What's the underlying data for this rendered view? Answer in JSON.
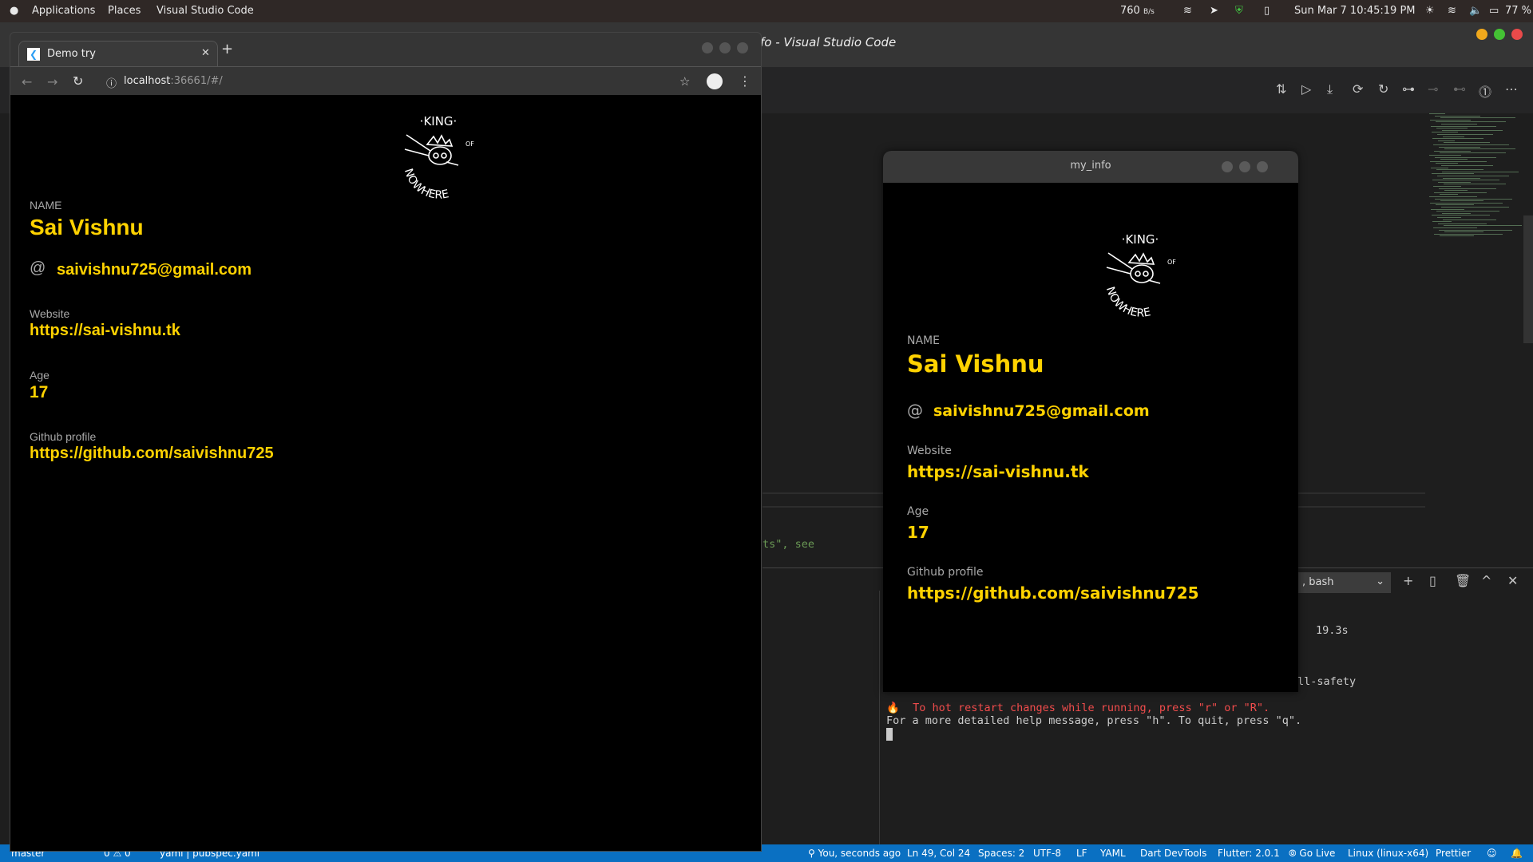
{
  "menubar": {
    "items": [
      "Applications",
      "Places",
      "Visual Studio Code"
    ],
    "net_speed": "760",
    "net_unit": "B/s",
    "datetime": "Sun Mar 7  10:45:19 PM",
    "battery": "77 %"
  },
  "vscode": {
    "title": "fo - Visual Studio Code",
    "editor_fragment": "ts\", see",
    "terminal": {
      "shell": ", bash",
      "time": "19.3s",
      "fragment": "ll-safety",
      "hot_restart": "To hot restart changes while running, press \"r\" or \"R\".",
      "help": "For a more detailed help message, press \"h\". To quit, press \"q\"."
    },
    "statusbar": {
      "left": [
        "master",
        "0 ⚠ 0",
        "yaml | pubspec.yaml"
      ],
      "right": [
        "You, seconds ago",
        "Ln 49, Col 24",
        "Spaces: 2",
        "UTF-8",
        "LF",
        "YAML",
        "Dart DevTools",
        "Flutter: 2.0.1",
        "Go Live",
        "Linux (linux-x64)",
        "Prettier"
      ]
    }
  },
  "browser": {
    "tab_title": "Demo try",
    "url_host": "localhost",
    "url_rest": ":36661/#/"
  },
  "app_window": {
    "title": "my_info"
  },
  "logo": {
    "top": "·KING·",
    "of": "OF",
    "bottom": "NOWHERE"
  },
  "profile": {
    "name_label": "NAME",
    "name": "Sai Vishnu",
    "email": "saivishnu725@gmail.com",
    "website_label": "Website",
    "website": "https://sai-vishnu.tk",
    "age_label": "Age",
    "age": "17",
    "github_label": "Github profile",
    "github": "https://github.com/saivishnu725"
  },
  "colors": {
    "accent": "#ffd200",
    "statusbar": "#0a70c2",
    "error": "#f14c4c"
  }
}
